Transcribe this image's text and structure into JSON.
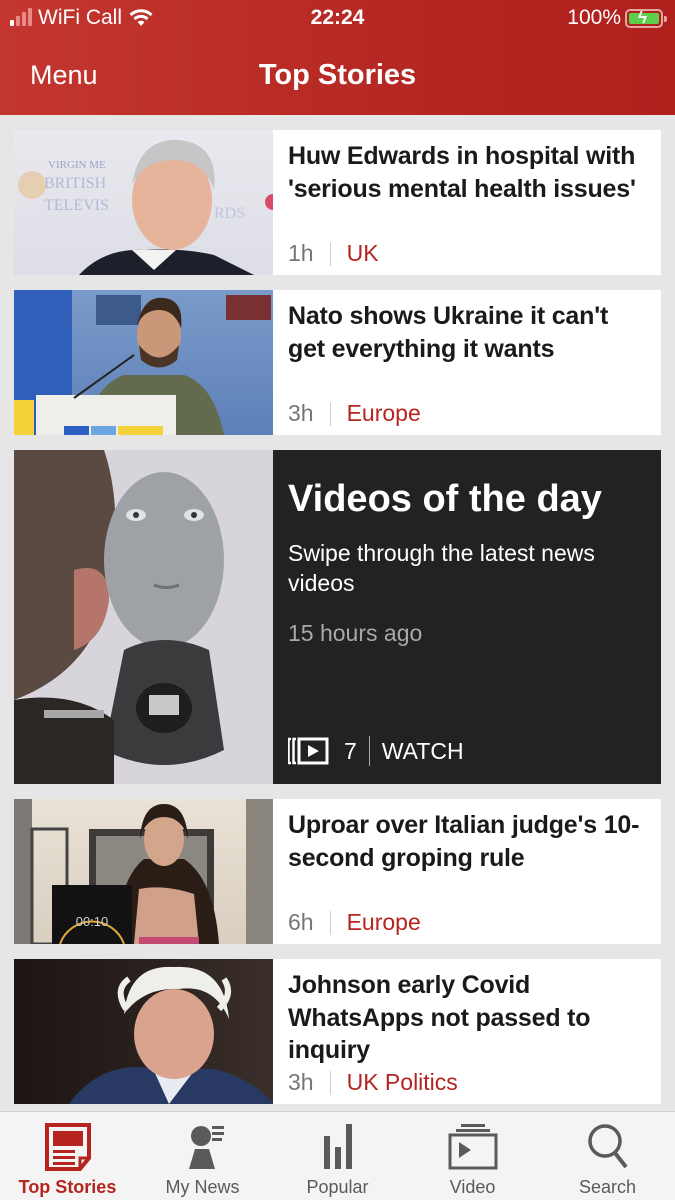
{
  "status_bar": {
    "carrier": "WiFi Call",
    "time": "22:24",
    "battery": "100%",
    "battery_level_percent": 100,
    "charging": true
  },
  "header": {
    "menu_label": "Menu",
    "title": "Top Stories"
  },
  "colors": {
    "brand_red": "#b5241f",
    "video_card_bg": "#222222",
    "meta_grey": "#767676"
  },
  "stories": [
    {
      "headline": "Huw Edwards in hospital with 'serious mental health issues'",
      "age": "1h",
      "category": "UK",
      "thumbnail": "Huw Edwards at BAFTA TV awards"
    },
    {
      "headline": "Nato shows Ukraine it can't get everything it wants",
      "age": "3h",
      "category": "Europe",
      "thumbnail": "Zelensky speaking at NATO podium"
    },
    {
      "headline": "Uproar over Italian judge's 10-second groping rule",
      "age": "6h",
      "category": "Europe",
      "thumbnail": "Woman with 00:10 timer",
      "thumb_timer": "00:10"
    },
    {
      "headline": "Johnson early Covid WhatsApps not passed to inquiry",
      "age": "3h",
      "category": "UK Politics",
      "thumbnail": "Boris Johnson"
    }
  ],
  "video_card": {
    "title": "Videos of the day",
    "subtitle": "Swipe through the latest news videos",
    "age": "15 hours ago",
    "count": "7",
    "watch_label": "WATCH",
    "thumbnail": "Humanoid robot face"
  },
  "tabbar": {
    "items": [
      {
        "label": "Top Stories",
        "icon": "newspaper-icon",
        "active": true
      },
      {
        "label": "My News",
        "icon": "person-news-icon",
        "active": false
      },
      {
        "label": "Popular",
        "icon": "bar-chart-icon",
        "active": false
      },
      {
        "label": "Video",
        "icon": "video-stack-icon",
        "active": false
      },
      {
        "label": "Search",
        "icon": "search-icon",
        "active": false
      }
    ]
  }
}
